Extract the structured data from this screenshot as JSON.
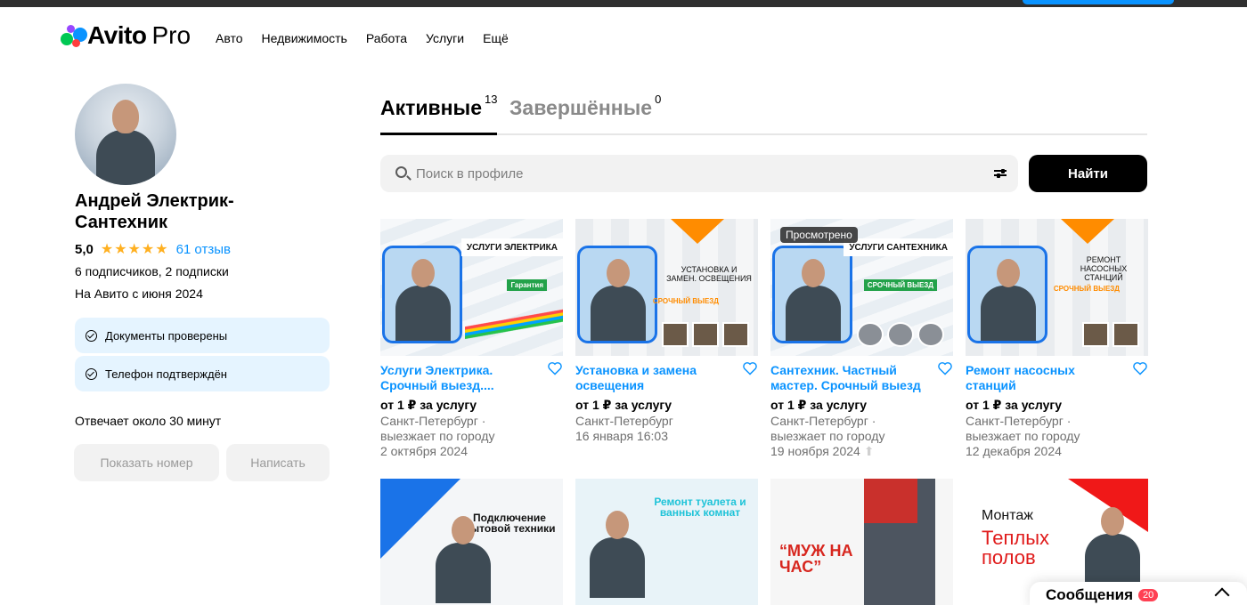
{
  "header": {
    "logo_text": "Avito",
    "logo_suffix": "Pro",
    "nav": [
      "Авто",
      "Недвижимость",
      "Работа",
      "Услуги",
      "Ещё"
    ]
  },
  "profile": {
    "name": "Андрей Электрик-Сантехник",
    "rating": "5,0",
    "stars": "★★★★★",
    "reviews": "61 отзыв",
    "followers": "6 подписчиков, 2 подписки",
    "member_since": "На Авито с июня 2024",
    "verifications": [
      "Документы проверены",
      "Телефон подтверждён"
    ],
    "response_time": "Отвечает около 30 минут",
    "show_phone": "Показать номер",
    "write": "Написать"
  },
  "tabs": [
    {
      "label": "Активные",
      "count": "13"
    },
    {
      "label": "Завершённые",
      "count": "0"
    }
  ],
  "search": {
    "placeholder": "Поиск в профиле",
    "button": "Найти"
  },
  "listings": [
    {
      "banner": "УСЛУГИ ЭЛЕКТРИКА",
      "tag": "Гарантия",
      "title": "Услуги Электрика. Срочный выезд....",
      "price": "от 1 ₽ за услугу",
      "meta1": "Санкт-Петербург ·",
      "meta2": "выезжает по городу",
      "meta3": "2 октября 2024"
    },
    {
      "banner": "УСТАНОВКА И ЗАМЕН. ОСВЕЩЕНИЯ",
      "tag": "СРОЧНЫЙ ВЫЕЗД",
      "title": "Установка и замена освещения",
      "price": "от 1 ₽ за услугу",
      "meta1": "Санкт-Петербург",
      "meta2": "16 января 16:03",
      "meta3": ""
    },
    {
      "banner": "УСЛУГИ САНТЕХНИКА",
      "tag": "СРОЧНЫЙ ВЫЕЗД",
      "badge": "Просмотрено",
      "title": "Сантехник. Частный мастер. Срочный выезд",
      "price": "от 1 ₽ за услугу",
      "meta1": "Санкт-Петербург ·",
      "meta2": "выезжает по городу",
      "meta3": "19 ноября 2024"
    },
    {
      "banner": "РЕМОНТ НАСОСНЫХ СТАНЦИЙ",
      "tag": "СРОЧНЫЙ ВЫЕЗД",
      "title": "Ремонт насосных станций",
      "price": "от 1 ₽ за услугу",
      "meta1": "Санкт-Петербург ·",
      "meta2": "выезжает по городу",
      "meta3": "12 декабря 2024"
    }
  ],
  "listings_row2": [
    {
      "text": "Подключение бытовой техники"
    },
    {
      "text": "Ремонт туалета и ванных комнат"
    },
    {
      "text": "“МУЖ НА ЧАС”"
    },
    {
      "text": "Монтаж",
      "text2": "Теплых полов"
    }
  ],
  "messages": {
    "label": "Сообщения",
    "count": "20"
  },
  "colors": {
    "accent": "#0a93ff",
    "star": "#ffb021",
    "verify_bg": "#e5f4ff",
    "badge": "#ff4053"
  }
}
